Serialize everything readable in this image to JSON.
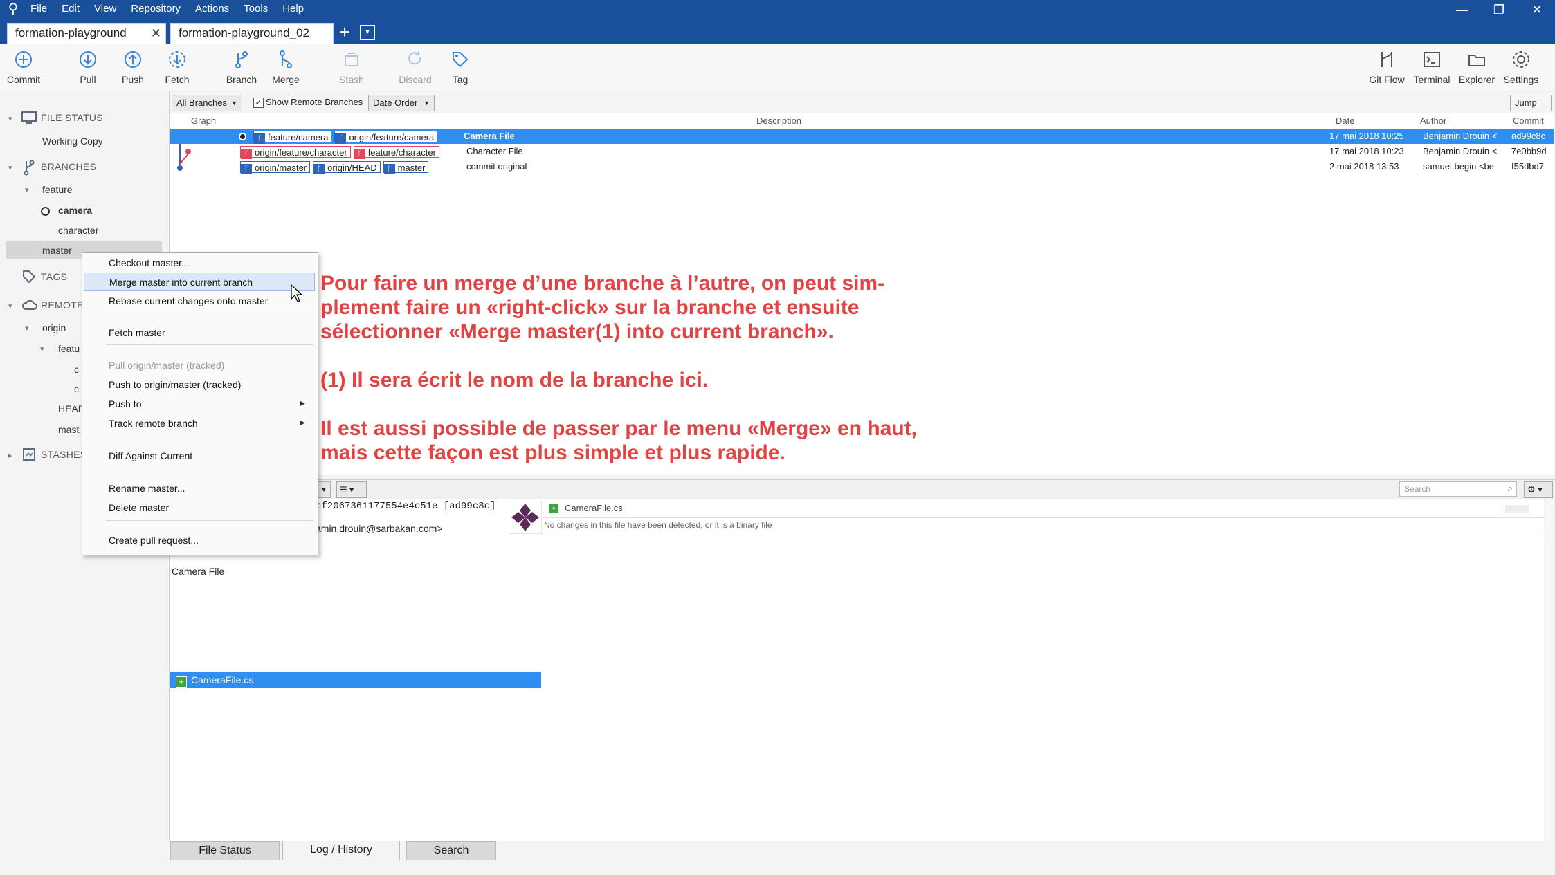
{
  "app": {
    "menu": [
      "File",
      "Edit",
      "View",
      "Repository",
      "Actions",
      "Tools",
      "Help"
    ],
    "tabs": [
      {
        "label": "formation-playground",
        "close": "✕"
      },
      {
        "label": "formation-playground_02"
      }
    ]
  },
  "toolbar": {
    "left": [
      {
        "label": "Commit",
        "icon": "commit-icon"
      },
      {
        "label": "Pull",
        "icon": "pull-icon"
      },
      {
        "label": "Push",
        "icon": "push-icon"
      },
      {
        "label": "Fetch",
        "icon": "fetch-icon"
      },
      {
        "label": "Branch",
        "icon": "branch-icon"
      },
      {
        "label": "Merge",
        "icon": "merge-icon"
      },
      {
        "label": "Stash",
        "icon": "stash-icon",
        "disabled": true
      },
      {
        "label": "Discard",
        "icon": "discard-icon",
        "disabled": true
      },
      {
        "label": "Tag",
        "icon": "tag-icon"
      }
    ],
    "right": [
      {
        "label": "Git Flow",
        "icon": "git-flow-icon"
      },
      {
        "label": "Terminal",
        "icon": "terminal-icon"
      },
      {
        "label": "Explorer",
        "icon": "explorer-icon"
      },
      {
        "label": "Settings",
        "icon": "settings-icon"
      }
    ]
  },
  "sidebar": {
    "file_status": "FILE STATUS",
    "working_copy": "Working Copy",
    "branches": "BRANCHES",
    "feature": "feature",
    "camera": "camera",
    "character": "character",
    "master": "master",
    "tags": "TAGS",
    "remotes": "REMOTES",
    "origin": "origin",
    "featu": "featu",
    "c1": "c",
    "c2": "c",
    "head": "HEAD",
    "mast": "mast",
    "stashes": "STASHES"
  },
  "filters": {
    "branches": "All Branches",
    "show_remote": "Show Remote Branches",
    "order": "Date Order",
    "jump": "Jump to:"
  },
  "log": {
    "columns": [
      "Graph",
      "Description",
      "Date",
      "Author",
      "Commit"
    ],
    "rows": [
      {
        "refs": [
          {
            "name": "feature/camera",
            "color": "blue"
          },
          {
            "name": "origin/feature/camera",
            "color": "blue"
          }
        ],
        "desc": "Camera File",
        "date": "17 mai 2018 10:25",
        "author": "Benjamin Drouin <",
        "commit": "ad99c8c",
        "selected": true
      },
      {
        "refs": [
          {
            "name": "origin/feature/character",
            "color": "red"
          },
          {
            "name": "feature/character",
            "color": "red"
          }
        ],
        "desc": "Character File",
        "date": "17 mai 2018 10:23",
        "author": "Benjamin Drouin <",
        "commit": "7e0bb9d"
      },
      {
        "refs": [
          {
            "name": "origin/master",
            "color": "blue"
          },
          {
            "name": "origin/HEAD",
            "color": "blue"
          },
          {
            "name": "master",
            "color": "blue"
          }
        ],
        "desc": "commit original",
        "date": "2 mai 2018 13:53",
        "author": "samuel begin <be",
        "commit": "f55dbd7"
      }
    ]
  },
  "annotation": {
    "p1": "Pour faire un merge d’une branche à l’autre, on peut sim-plement faire un «right-click» sur la branche et ensuite sélectionner «Merge master(1) into current branch».",
    "p2": "(1) Il sera écrit le nom de la branche ici.",
    "p3": "Il est aussi possible de passer par le menu «Merge» en haut, mais cette façon est plus simple et plus rapide."
  },
  "context_menu": {
    "items": [
      {
        "label": "Checkout master..."
      },
      {
        "label": "Merge master into current branch",
        "highlight": true
      },
      {
        "label": "Rebase current changes onto master"
      },
      {
        "label": "Fetch master"
      },
      {
        "label": "Pull origin/master (tracked)",
        "disabled": true
      },
      {
        "label": "Push to origin/master (tracked)"
      },
      {
        "label": "Push to",
        "submenu": true
      },
      {
        "label": "Track remote branch",
        "submenu": true
      },
      {
        "label": "Diff Against Current"
      },
      {
        "label": "Rename master..."
      },
      {
        "label": "Delete master"
      },
      {
        "label": "Create pull request..."
      }
    ]
  },
  "details": {
    "hash": "cf2067361177554e4c51e [ad99c8c]",
    "email": "amin.drouin@sarbakan.com>",
    "message": "Camera File",
    "file": "CameraFile.cs",
    "diff_file": "CameraFile.cs",
    "diff_note": "No changes in this file have been detected, or it is a binary file",
    "search_placeholder": "Search"
  },
  "bottom_tabs": [
    "File Status",
    "Log / History",
    "Search"
  ],
  "colors": {
    "accent": "#1a4f9c",
    "selection": "#2f8ef0",
    "annotation": "#e24343",
    "branch_red": "#e2485a",
    "branch_blue": "#2b64b8"
  }
}
